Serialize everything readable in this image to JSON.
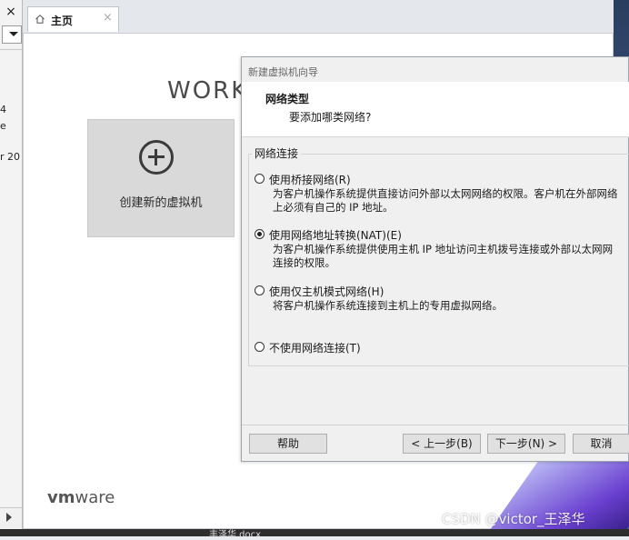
{
  "left_panel": {
    "close_glyph": "×",
    "texts": [
      "4",
      "e",
      "r 20"
    ]
  },
  "tab": {
    "label": "主页",
    "close_glyph": "×"
  },
  "home": {
    "title_fragment": "WORK",
    "create_vm_label": "创建新的虚拟机",
    "logo_bold": "vm",
    "logo_rest": "ware"
  },
  "dialog": {
    "window_title": "新建虚拟机向导",
    "header_title": "网络类型",
    "header_subtitle": "要添加哪类网络?",
    "group_label": "网络连接",
    "options": [
      {
        "label": "使用桥接网络(R)",
        "desc1": "为客户机操作系统提供直接访问外部以太网网络的权限。客户机在外部网络",
        "desc2": "上必须有自己的 IP 地址。",
        "selected": false
      },
      {
        "label": "使用网络地址转换(NAT)(E)",
        "desc1": "为客户机操作系统提供使用主机 IP 地址访问主机拨号连接或外部以太网网",
        "desc2": "连接的权限。",
        "selected": true
      },
      {
        "label": "使用仅主机模式网络(H)",
        "desc1": "将客户机操作系统连接到主机上的专用虚拟网络。",
        "desc2": "",
        "selected": false
      },
      {
        "label": "不使用网络连接(T)",
        "desc1": "",
        "desc2": "",
        "selected": false
      }
    ],
    "buttons": {
      "help": "帮助",
      "back": "< 上一步(B)",
      "next": "下一步(N) >",
      "cancel": "取消"
    }
  },
  "taskbar_text": "丰泽华.docx",
  "watermark": "CSDN @victor_王泽华"
}
